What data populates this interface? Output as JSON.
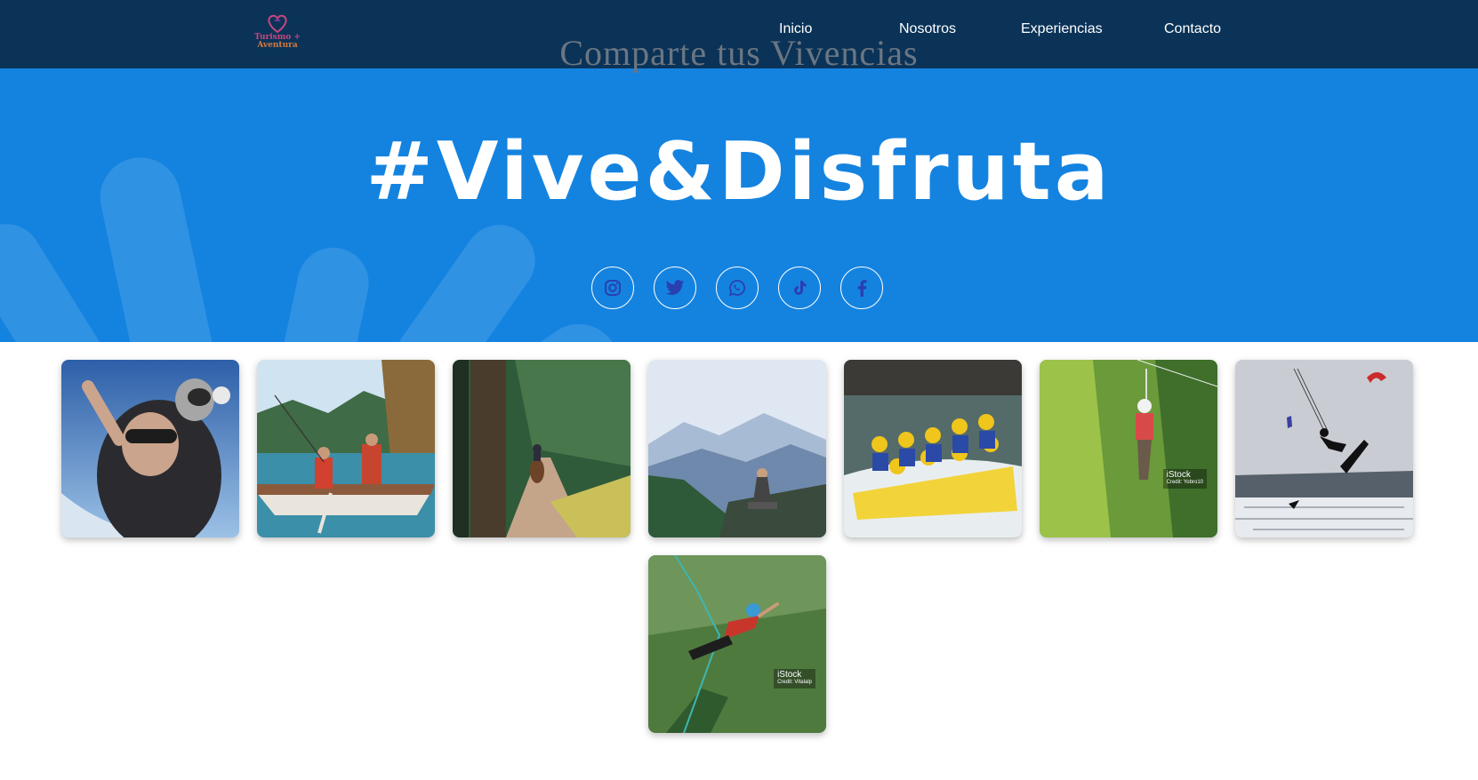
{
  "header": {
    "logo_line1": "Turismo +",
    "logo_line2": "Aventura",
    "nav": [
      {
        "label": "Inicio"
      },
      {
        "label": "Nosotros"
      },
      {
        "label": "Experiencias"
      },
      {
        "label": "Contacto"
      }
    ],
    "overlay_title": "Comparte tus Vivencias"
  },
  "hero": {
    "hashtag": "#Vive&Disfruta",
    "socials": [
      {
        "icon": "instagram-icon"
      },
      {
        "icon": "twitter-icon"
      },
      {
        "icon": "whatsapp-icon"
      },
      {
        "icon": "tiktok-icon"
      },
      {
        "icon": "facebook-icon"
      }
    ]
  },
  "gallery": {
    "watermark_brand": "iStock",
    "photo6_credit": "Credit: Yobro10",
    "photo8_credit": "Credit: Vitalalp"
  },
  "colors": {
    "topbar": "#0b3358",
    "hero": "#1483e0",
    "icon": "#2a3fb0"
  }
}
